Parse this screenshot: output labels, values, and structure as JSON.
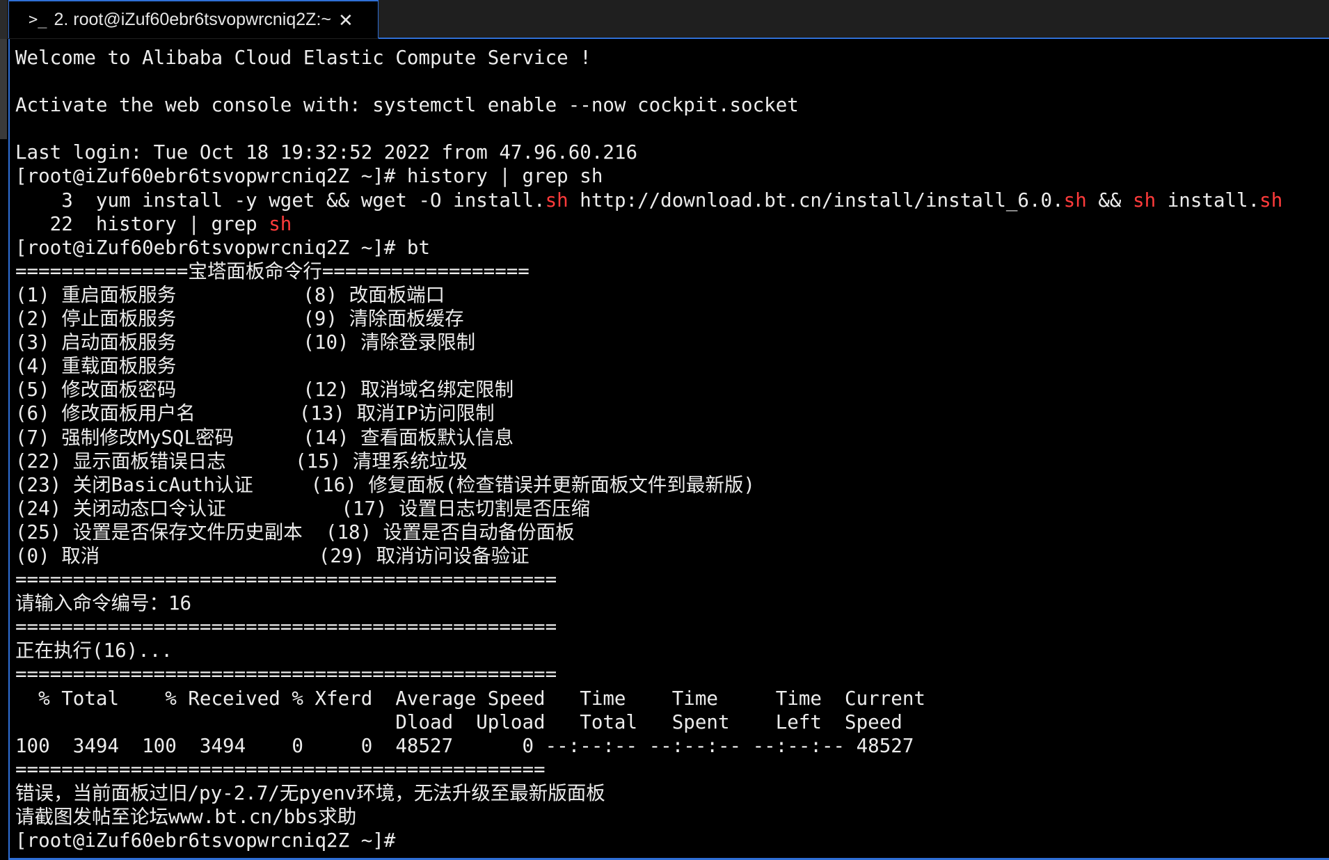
{
  "tab": {
    "title": "2. root@iZuf60ebr6tsvopwrcniq2Z:~",
    "icon": "terminal-prompt-icon",
    "close_glyph": "✕"
  },
  "colors": {
    "background": "#000000",
    "text": "#ececec",
    "highlight": "#ff3b3b",
    "accent": "#2f6fd6"
  },
  "terminal": {
    "lines": [
      [
        {
          "t": "Welcome to Alibaba Cloud Elastic Compute Service !"
        }
      ],
      [
        {
          "t": ""
        }
      ],
      [
        {
          "t": "Activate the web console with: systemctl enable --now cockpit.socket"
        }
      ],
      [
        {
          "t": ""
        }
      ],
      [
        {
          "t": "Last login: Tue Oct 18 19:32:52 2022 from 47.96.60.216"
        }
      ],
      [
        {
          "t": "[root@iZuf60ebr6tsvopwrcniq2Z ~]# history | grep sh"
        }
      ],
      [
        {
          "t": "    3  yum install -y wget && wget -O install."
        },
        {
          "t": "sh",
          "hl": true
        },
        {
          "t": " http://download.bt.cn/install/install_6.0."
        },
        {
          "t": "sh",
          "hl": true
        },
        {
          "t": " && "
        },
        {
          "t": "sh",
          "hl": true
        },
        {
          "t": " install."
        },
        {
          "t": "sh",
          "hl": true
        }
      ],
      [
        {
          "t": "   22  history | grep "
        },
        {
          "t": "sh",
          "hl": true
        }
      ],
      [
        {
          "t": "[root@iZuf60ebr6tsvopwrcniq2Z ~]# bt"
        }
      ],
      [
        {
          "t": "===============宝塔面板命令行=================="
        }
      ],
      [
        {
          "t": "(1) 重启面板服务           (8) 改面板端口"
        }
      ],
      [
        {
          "t": "(2) 停止面板服务           (9) 清除面板缓存"
        }
      ],
      [
        {
          "t": "(3) 启动面板服务           (10) 清除登录限制"
        }
      ],
      [
        {
          "t": "(4) 重载面板服务"
        }
      ],
      [
        {
          "t": "(5) 修改面板密码           (12) 取消域名绑定限制"
        }
      ],
      [
        {
          "t": "(6) 修改面板用户名         (13) 取消IP访问限制"
        }
      ],
      [
        {
          "t": "(7) 强制修改MySQL密码      (14) 查看面板默认信息"
        }
      ],
      [
        {
          "t": "(22) 显示面板错误日志      (15) 清理系统垃圾"
        }
      ],
      [
        {
          "t": "(23) 关闭BasicAuth认证     (16) 修复面板(检查错误并更新面板文件到最新版)"
        }
      ],
      [
        {
          "t": "(24) 关闭动态口令认证          (17) 设置日志切割是否压缩"
        }
      ],
      [
        {
          "t": "(25) 设置是否保存文件历史副本  (18) 设置是否自动备份面板"
        }
      ],
      [
        {
          "t": "(0) 取消                   (29) 取消访问设备验证"
        }
      ],
      [
        {
          "t": "==============================================="
        }
      ],
      [
        {
          "t": "请输入命令编号：16"
        }
      ],
      [
        {
          "t": "==============================================="
        }
      ],
      [
        {
          "t": "正在执行(16)..."
        }
      ],
      [
        {
          "t": "==============================================="
        }
      ],
      [
        {
          "t": "  % Total    % Received % Xferd  Average Speed   Time    Time     Time  Current"
        }
      ],
      [
        {
          "t": "                                 Dload  Upload   Total   Spent    Left  Speed"
        }
      ],
      [
        {
          "t": "100  3494  100  3494    0     0  48527      0 --:--:-- --:--:-- --:--:-- 48527"
        }
      ],
      [
        {
          "t": "=============================================="
        }
      ],
      [
        {
          "t": "错误，当前面板过旧/py-2.7/无pyenv环境，无法升级至最新版面板"
        }
      ],
      [
        {
          "t": "请截图发帖至论坛www.bt.cn/bbs求助"
        }
      ],
      [
        {
          "t": "[root@iZuf60ebr6tsvopwrcniq2Z ~]#"
        }
      ]
    ]
  }
}
